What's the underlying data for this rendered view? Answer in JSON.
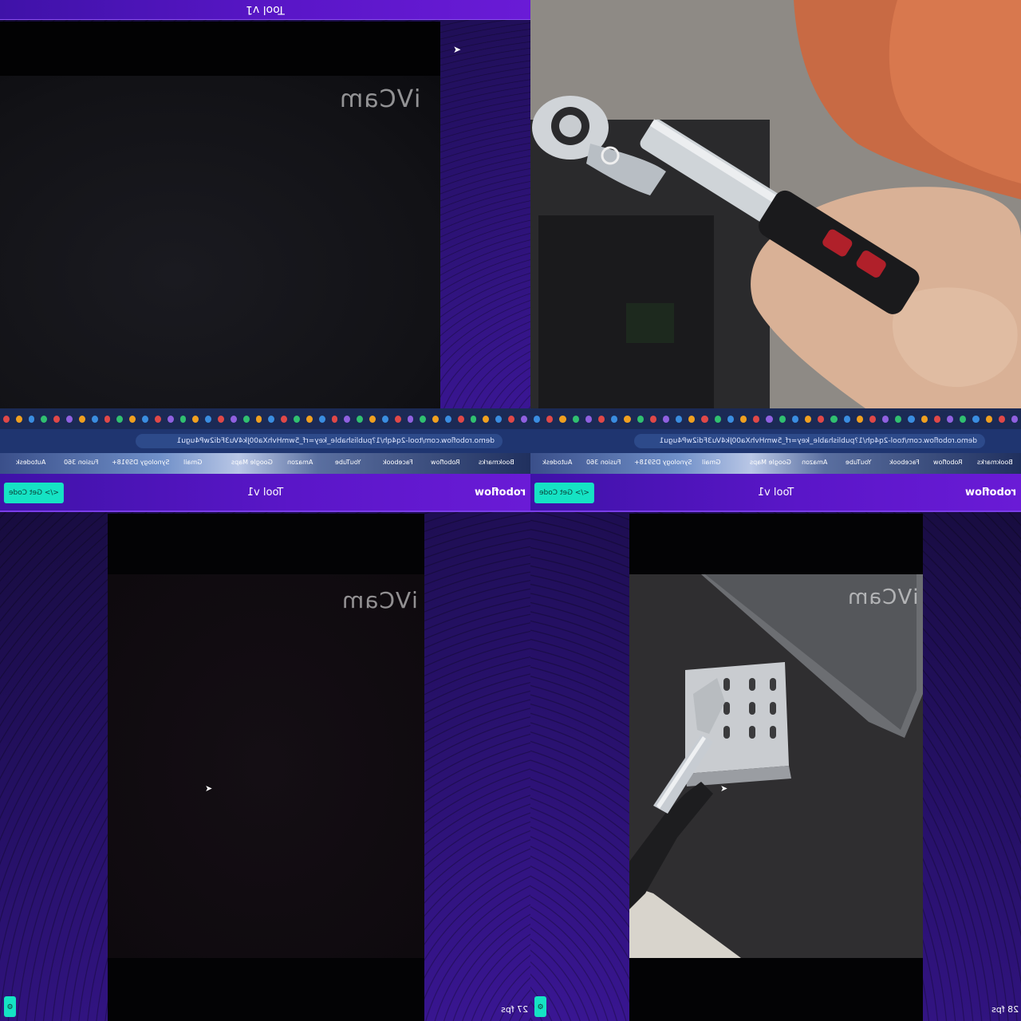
{
  "top_left": {
    "app_title": "Tool v1",
    "watermark": "iVCam"
  },
  "browser_left": {
    "url": "demo.roboflow.com/tool-2q4qh/1?publishable_key=rf_5wmHvhXa00Jk4Vu3Fdi2wP4ugu1",
    "bookmarks": [
      "Bookmarks",
      "Roboflow",
      "Facebook",
      "YouTube",
      "Amazon",
      "Google Maps",
      "Gmail",
      "Synology DS918+",
      "Fusion 360",
      "Autodesk"
    ]
  },
  "browser_right": {
    "url": "demo.roboflow.com/tool-2q4qh/1?publishable_key=rf_5wmHvhXa00Jk4Vu3Fdi2wP4ugu1",
    "bookmarks": [
      "Bookmarks",
      "Roboflow",
      "Facebook",
      "YouTube",
      "Amazon",
      "Google Maps",
      "Gmail",
      "Synology DS918+",
      "Fusion 360",
      "Autodesk"
    ]
  },
  "bottom_left": {
    "logo": "roboflow",
    "title": "Tool v1",
    "get_code_label": "</> Get Code",
    "watermark": "iVCam",
    "fps": "27 fps"
  },
  "bottom_right": {
    "logo": "roboflow",
    "title": "Tool v1",
    "get_code_label": "</> Get Code",
    "watermark": "iVCam",
    "fps": "28 fps"
  },
  "colors": {
    "header_purple": "#5a16c8",
    "accent_teal": "#15e3c4",
    "background_navy": "#241063"
  },
  "icons": {
    "settings": "gear-icon",
    "code": "code-icon",
    "cursor": "mouse-pointer-icon"
  }
}
